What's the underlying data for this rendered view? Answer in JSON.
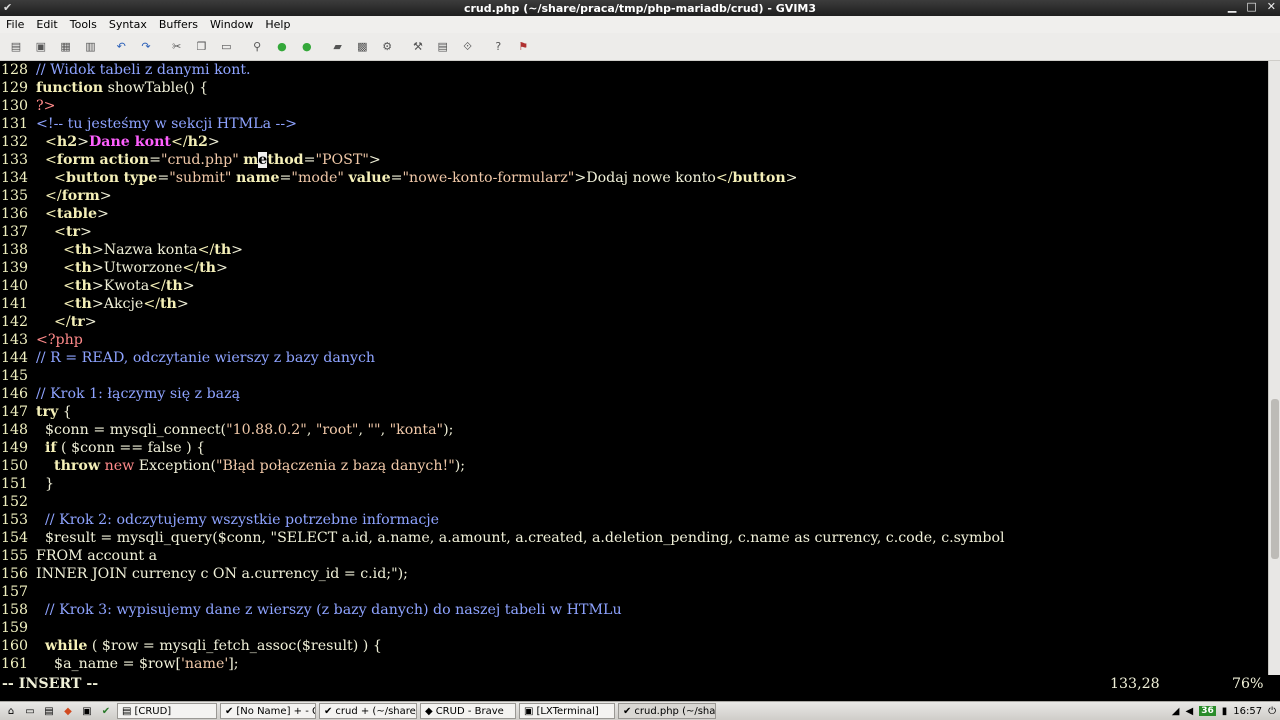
{
  "window": {
    "title": "crud.php (~/share/praca/tmp/php-mariadb/crud) - GVIM3"
  },
  "menu": [
    "File",
    "Edit",
    "Tools",
    "Syntax",
    "Buffers",
    "Window",
    "Help"
  ],
  "toolbar_icons": [
    "open-icon",
    "save-icon",
    "save-all-icon",
    "print-icon",
    "sep",
    "undo-icon",
    "redo-icon",
    "sep",
    "cut-icon",
    "copy-icon",
    "paste-icon",
    "sep",
    "find-replace-icon",
    "find-next-icon",
    "find-prev-icon",
    "sep",
    "load-session-icon",
    "save-session-icon",
    "run-script-icon",
    "sep",
    "make-icon",
    "shell-icon",
    "tags-icon",
    "sep",
    "help-icon",
    "find-help-icon"
  ],
  "editor": {
    "lines": [
      {
        "n": "128",
        "t": "// Widok tabeli z danymi kont."
      },
      {
        "n": "129",
        "t": "function showTable() {"
      },
      {
        "n": "130",
        "t": "?>"
      },
      {
        "n": "131",
        "t": "<!-- tu jesteśmy w sekcji HTMLa -->"
      },
      {
        "n": "132",
        "t": "  <h2>Dane kont</h2>"
      },
      {
        "n": "133",
        "t": "  <form action=\"crud.php\" method=\"POST\">"
      },
      {
        "n": "134",
        "t": "    <button type=\"submit\" name=\"mode\" value=\"nowe-konto-formularz\">Dodaj nowe konto</button>"
      },
      {
        "n": "135",
        "t": "  </form>"
      },
      {
        "n": "136",
        "t": "  <table>"
      },
      {
        "n": "137",
        "t": "    <tr>"
      },
      {
        "n": "138",
        "t": "      <th>Nazwa konta</th>"
      },
      {
        "n": "139",
        "t": "      <th>Utworzone</th>"
      },
      {
        "n": "140",
        "t": "      <th>Kwota</th>"
      },
      {
        "n": "141",
        "t": "      <th>Akcje</th>"
      },
      {
        "n": "142",
        "t": "    </tr>"
      },
      {
        "n": "143",
        "t": "<?php"
      },
      {
        "n": "144",
        "t": "// R = READ, odczytanie wierszy z bazy danych"
      },
      {
        "n": "145",
        "t": ""
      },
      {
        "n": "146",
        "t": "// Krok 1: łączymy się z bazą"
      },
      {
        "n": "147",
        "t": "try {"
      },
      {
        "n": "148",
        "t": "  $conn = mysqli_connect(\"10.88.0.2\", \"root\", \"\", \"konta\");"
      },
      {
        "n": "149",
        "t": "  if ( $conn == false ) {"
      },
      {
        "n": "150",
        "t": "    throw new Exception(\"Błąd połączenia z bazą danych!\");"
      },
      {
        "n": "151",
        "t": "  }"
      },
      {
        "n": "152",
        "t": ""
      },
      {
        "n": "153",
        "t": "  // Krok 2: odczytujemy wszystkie potrzebne informacje"
      },
      {
        "n": "154",
        "t": "  $result = mysqli_query($conn, \"SELECT a.id, a.name, a.amount, a.created, a.deletion_pending, c.name as currency, c.code, c.symbol"
      },
      {
        "n": "155",
        "t": "FROM account a"
      },
      {
        "n": "156",
        "t": "INNER JOIN currency c ON a.currency_id = c.id;\");"
      },
      {
        "n": "157",
        "t": ""
      },
      {
        "n": "158",
        "t": "  // Krok 3: wypisujemy dane z wierszy (z bazy danych) do naszej tabeli w HTMLu"
      },
      {
        "n": "159",
        "t": ""
      },
      {
        "n": "160",
        "t": "  while ( $row = mysqli_fetch_assoc($result) ) {"
      },
      {
        "n": "161",
        "t": "    $a_name = $row['name'];"
      }
    ]
  },
  "status": {
    "mode": "-- INSERT --",
    "position": "133,28",
    "percent": "76%"
  },
  "taskbar": {
    "tasks": [
      {
        "label": "[CRUD]",
        "icon": "folder-icon"
      },
      {
        "label": "[No Name] + - G...",
        "icon": "vim-icon"
      },
      {
        "label": "crud + (~/share/...",
        "icon": "vim-icon"
      },
      {
        "label": "CRUD - Brave",
        "icon": "brave-icon"
      },
      {
        "label": "[LXTerminal]",
        "icon": "terminal-icon"
      },
      {
        "label": "crud.php (~/share...",
        "icon": "vim-icon",
        "active": true
      }
    ],
    "badge": "36",
    "clock": "16:57"
  }
}
